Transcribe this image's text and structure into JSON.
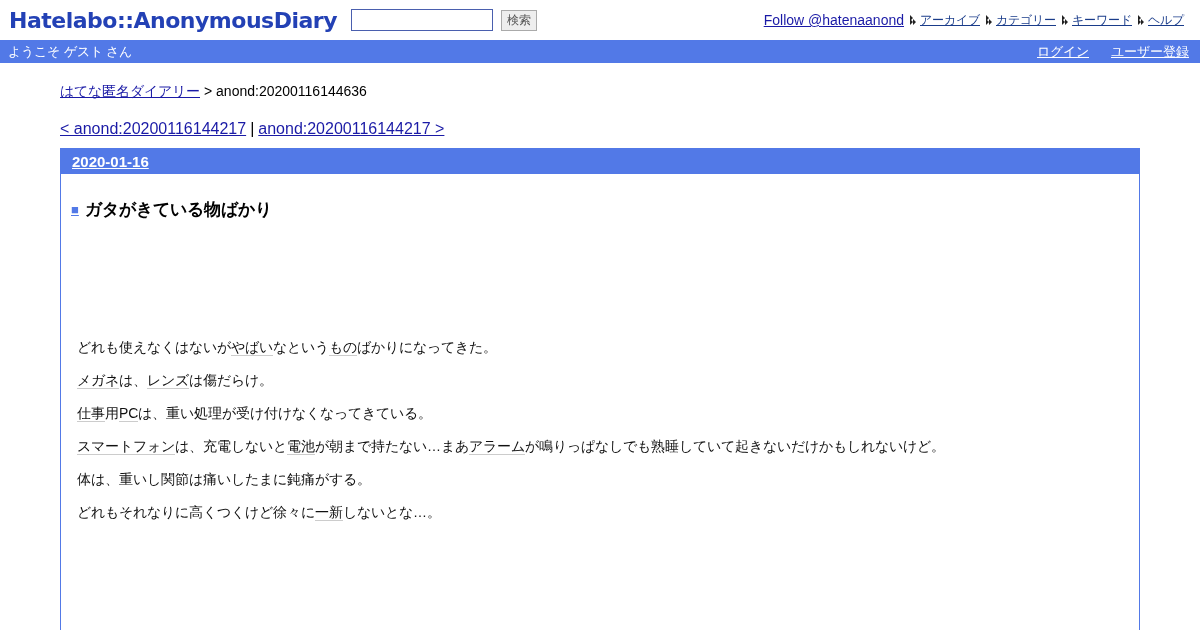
{
  "header": {
    "logo": "Hatelabo::AnonymousDiary",
    "search": {
      "button": "検索"
    },
    "follow_link": "Follow @hatenaanond",
    "nav": [
      "アーカイブ",
      "カテゴリー",
      "キーワード",
      "ヘルプ"
    ]
  },
  "bar": {
    "welcome": "ようこそ ゲスト さん",
    "links": [
      "ログイン",
      "ユーザー登録"
    ]
  },
  "breadcrumb": {
    "home": "はてな匿名ダイアリー",
    "current": "> anond:20200116144636"
  },
  "pager": {
    "prev": "< anond:20200116144217",
    "separator": "|",
    "next": "anond:20200116144217 >"
  },
  "day": {
    "date": "2020-01-16",
    "section_mark": "■",
    "title": "ガタがきている物ばかり",
    "paragraphs": [
      [
        {
          "text": "どれも使えなくはないが",
          "keyword": false
        },
        {
          "text": "やばい",
          "keyword": true
        },
        {
          "text": "なという",
          "keyword": false
        },
        {
          "text": "もの",
          "keyword": true
        },
        {
          "text": "ばかりになってきた。",
          "keyword": false
        }
      ],
      [
        {
          "text": "メガネ",
          "keyword": true
        },
        {
          "text": "は、",
          "keyword": false
        },
        {
          "text": "レンズ",
          "keyword": true
        },
        {
          "text": "は傷だらけ。",
          "keyword": false
        }
      ],
      [
        {
          "text": "仕事",
          "keyword": true
        },
        {
          "text": "用",
          "keyword": false
        },
        {
          "text": "PC",
          "keyword": true
        },
        {
          "text": "は、重い処理が受け付けなくなってきている。",
          "keyword": false
        }
      ],
      [
        {
          "text": "スマートフォン",
          "keyword": true
        },
        {
          "text": "は、充電しないと",
          "keyword": false
        },
        {
          "text": "電池",
          "keyword": true
        },
        {
          "text": "が朝まで持たない…まあ",
          "keyword": false
        },
        {
          "text": "アラーム",
          "keyword": true
        },
        {
          "text": "が鳴りっぱなしでも熟睡していて起きないだけかもしれないけど。",
          "keyword": false
        }
      ],
      [
        {
          "text": "体は、重いし関節は痛いしたまに鈍痛がする。",
          "keyword": false
        }
      ],
      [
        {
          "text": "どれもそれなりに高くつくけど徐々に",
          "keyword": false
        },
        {
          "text": "一新",
          "keyword": true
        },
        {
          "text": "しないとな…。",
          "keyword": false
        }
      ]
    ]
  }
}
